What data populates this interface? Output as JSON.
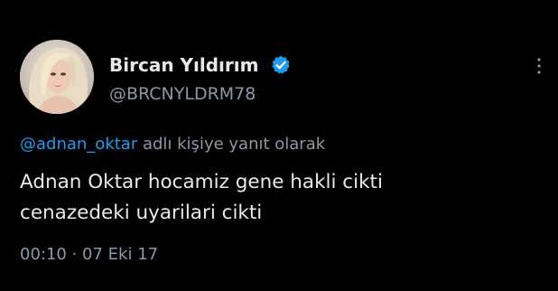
{
  "colors": {
    "background": "#000000",
    "text_primary": "#e7e9ea",
    "text_secondary": "#8b98a5",
    "accent": "#1d9bf0"
  },
  "author": {
    "display_name": "Bircan Yıldırım",
    "handle": "@BRCNYLDRM78",
    "verified_icon": "verified-badge-icon"
  },
  "reply": {
    "mention": "@adnan_oktar",
    "suffix": " adlı kişiye yanıt olarak"
  },
  "tweet": {
    "lines": [
      "Adnan Oktar hocamiz gene hakli cikti",
      "cenazedeki uyarilari cikti"
    ]
  },
  "meta": {
    "time": "00:10",
    "separator": " · ",
    "date": "07 Eki 17"
  },
  "menu": {
    "icon": "more-options-icon"
  }
}
